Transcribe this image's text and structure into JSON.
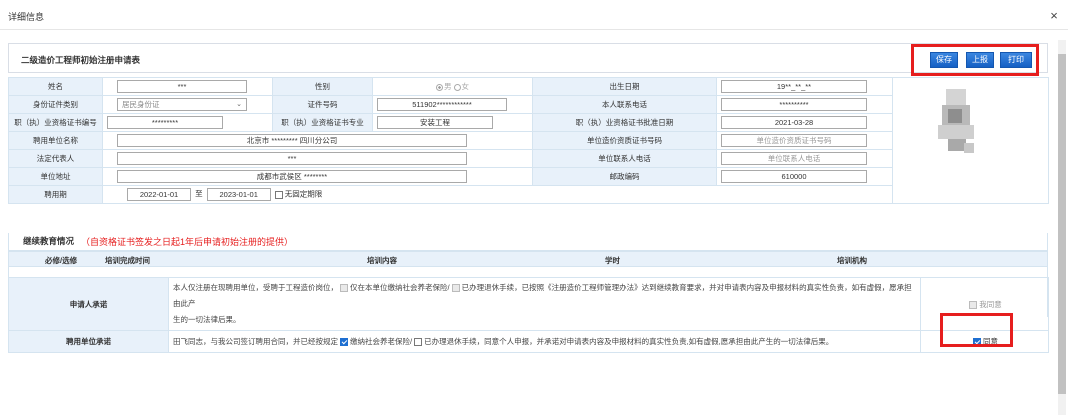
{
  "dialog": {
    "title": "详细信息",
    "close": "×"
  },
  "form": {
    "title": "二级造价工程师初始注册申请表",
    "buttons": {
      "save": "保存",
      "report": "上报",
      "print": "打印"
    }
  },
  "fields": {
    "name_label": "姓名",
    "name_value": "***",
    "gender_label": "性别",
    "gender_male": "男",
    "gender_female": "女",
    "birth_label": "出生日期",
    "birth_value": "19**_**_**",
    "idtype_label": "身份证件类别",
    "idtype_value": "居民身份证",
    "idno_label": "证件号码",
    "idno_value": "511902************",
    "phone_label": "本人联系电话",
    "phone_value": "**********",
    "certno_label": "职（执）业资格证书编号",
    "certno_value": "*********",
    "major_label": "职（执）业资格证书专业",
    "major_value": "安装工程",
    "certdate_label": "职（执）业资格证书批准日期",
    "certdate_value": "2021-03-28",
    "employer_label": "聘用单位名称",
    "employer_value": "北京市 ********* 四川分公司",
    "qualno_label": "单位造价资质证书号码",
    "qualno_value": "单位造价资质证书号码",
    "legal_label": "法定代表人",
    "legal_value": "***",
    "unitphone_label": "单位联系人电话",
    "unitphone_value": "单位联系人电话",
    "address_label": "单位地址",
    "address_value": "成都市武侯区 ********",
    "postcode_label": "邮政编码",
    "postcode_value": "610000",
    "period_label": "聘用期",
    "period_from": "2022-01-01",
    "period_sep": "至",
    "period_to": "2023-01-01",
    "period_nolimit": "无固定期限"
  },
  "education": {
    "title": "继续教育情况",
    "note": "（自资格证书签发之日起1年后申请初始注册的提供）",
    "columns": [
      "必修/选修",
      "培训完成时间",
      "培训内容",
      "学时",
      "培训机构"
    ]
  },
  "promises": {
    "applicant_label": "申请人承诺",
    "applicant_text_a": "本人仅注册在现聘用单位，受聘于工程造价岗位，",
    "applicant_text_b": "仅在本单位缴纳社会养老保险/",
    "applicant_text_c": "已办理退休手续，已按照《注册造价工程师管理办法》达到继续教育要求，并对申请表内容及申报材料的真实性负责，如有虚假，愿承担由此产",
    "applicant_text_d": "生的一切法律后果。",
    "applicant_agree": "我同意",
    "employer_label": "聘用单位承诺",
    "employer_text_a": "田飞同志，与我公司签订聘用合同，并已经按规定",
    "employer_text_b": "缴纳社会养老保险/",
    "employer_text_c": "已办理退休手续，同意个人申报，并承诺对申请表内容及申报材料的真实性负责,如有虚假,愿承担由此产生的一切法律后果。",
    "employer_agree": "同意"
  }
}
